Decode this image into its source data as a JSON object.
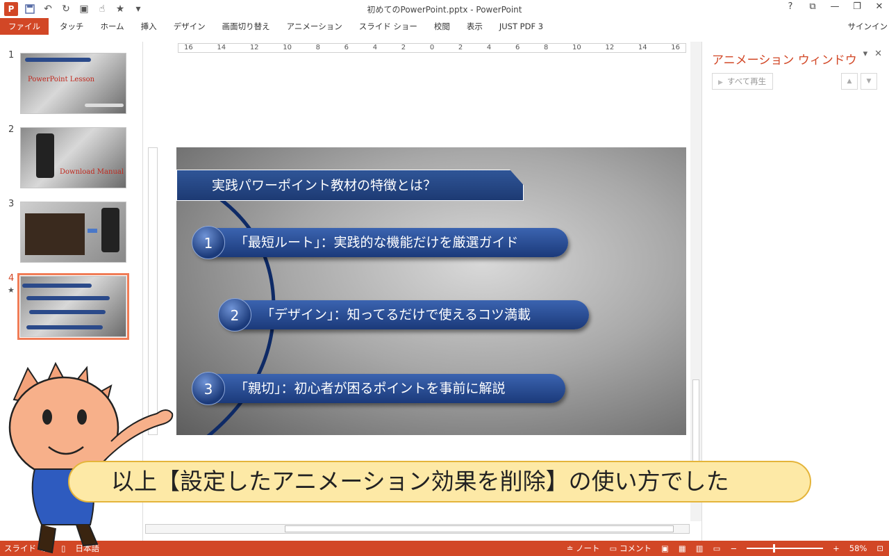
{
  "window": {
    "title": "初めてのPowerPoint.pptx - PowerPoint",
    "buttons": [
      "?",
      "⧉",
      "—",
      "❐",
      "✕"
    ],
    "app_icon_letter": "P"
  },
  "ribbon": {
    "file_tab": "ファイル",
    "tabs": [
      "タッチ",
      "ホーム",
      "挿入",
      "デザイン",
      "画面切り替え",
      "アニメーション",
      "スライド ショー",
      "校閲",
      "表示",
      "JUST PDF 3"
    ],
    "signin": "サインイン"
  },
  "thumbnails": {
    "items": [
      {
        "number": "1",
        "title_mark": "PowerPoint  Lesson"
      },
      {
        "number": "2",
        "title_mark": "Download  Manual"
      },
      {
        "number": "3"
      },
      {
        "number": "4",
        "marker": "★"
      }
    ]
  },
  "ruler": {
    "h_ticks": [
      "16",
      "14",
      "12",
      "10",
      "8",
      "6",
      "4",
      "2",
      "0",
      "2",
      "4",
      "6",
      "8",
      "10",
      "12",
      "14",
      "16"
    ]
  },
  "slide": {
    "title": "実践パワーポイント教材の特徴とは？",
    "items": [
      {
        "num": "1",
        "text": "「最短ルート」：実践的な機能だけを厳選ガイド"
      },
      {
        "num": "2",
        "text": "「デザイン」：知ってるだけで使えるコツ満載"
      },
      {
        "num": "3",
        "text": "「親切」：初心者が困るポイントを事前に解説"
      }
    ]
  },
  "animation_pane": {
    "title": "アニメーション ウィンドウ",
    "play_all": "すべて再生",
    "controls": [
      "▾",
      "✕"
    ]
  },
  "statusbar": {
    "slide_info": "スライド 4/4",
    "language": "日本語",
    "notes": "ノート",
    "comments": "コメント",
    "zoom": "58%"
  },
  "caption": {
    "text": "以上【設定したアニメーション効果を削除】の使い方でした"
  },
  "colors": {
    "accent": "#d24726",
    "slide_blue": "#2f5597",
    "caption_bg": "#fde9a6"
  }
}
